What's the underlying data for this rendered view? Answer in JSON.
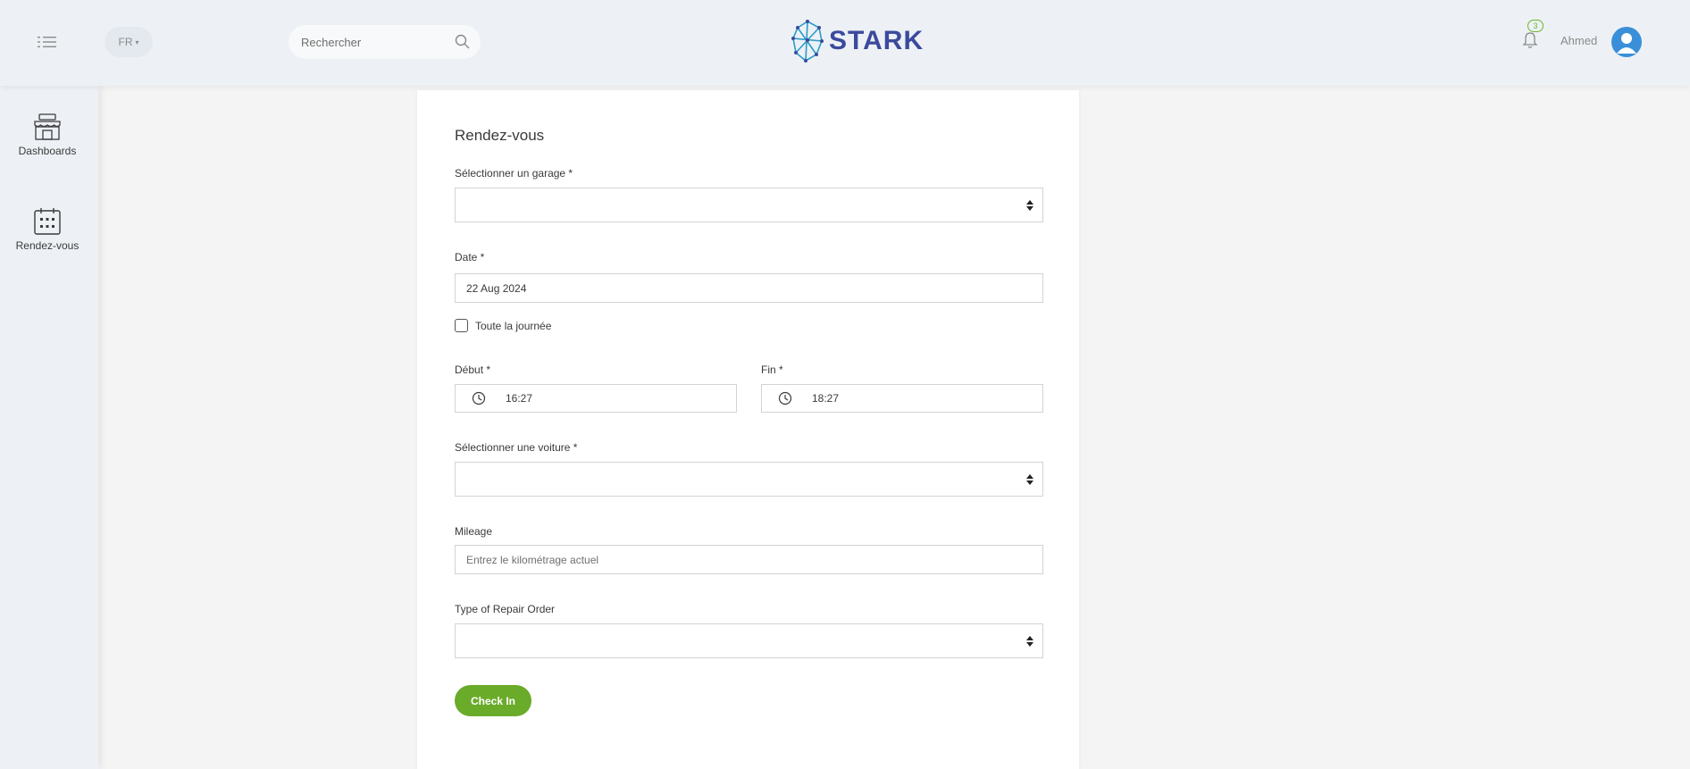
{
  "header": {
    "language": "FR",
    "search_placeholder": "Rechercher",
    "brand": "STARK",
    "notification_count": "3",
    "user_name": "Ahmed"
  },
  "sidebar": {
    "items": [
      {
        "label": "Dashboards",
        "icon": "shop-icon"
      },
      {
        "label": "Rendez-vous",
        "icon": "calendar-icon"
      }
    ]
  },
  "form": {
    "title": "Rendez-vous",
    "garage_label": "Sélectionner un garage *",
    "garage_value": "",
    "date_label": "Date *",
    "date_value": "22 Aug 2024",
    "all_day_label": "Toute la journée",
    "all_day_checked": false,
    "start_label": "Début *",
    "start_value": "16:27",
    "end_label": "Fin *",
    "end_value": "18:27",
    "car_label": "Sélectionner une voiture *",
    "car_value": "",
    "mileage_label": "Mileage",
    "mileage_placeholder": "Entrez le kilométrage actuel",
    "repair_type_label": "Type of Repair Order",
    "repair_type_value": "",
    "submit_label": "Check In"
  },
  "colors": {
    "accent_green": "#6aab2a",
    "brand_blue": "#3b4a9c",
    "avatar_blue": "#3a8fd8",
    "topbar_bg": "#edf1f5"
  }
}
